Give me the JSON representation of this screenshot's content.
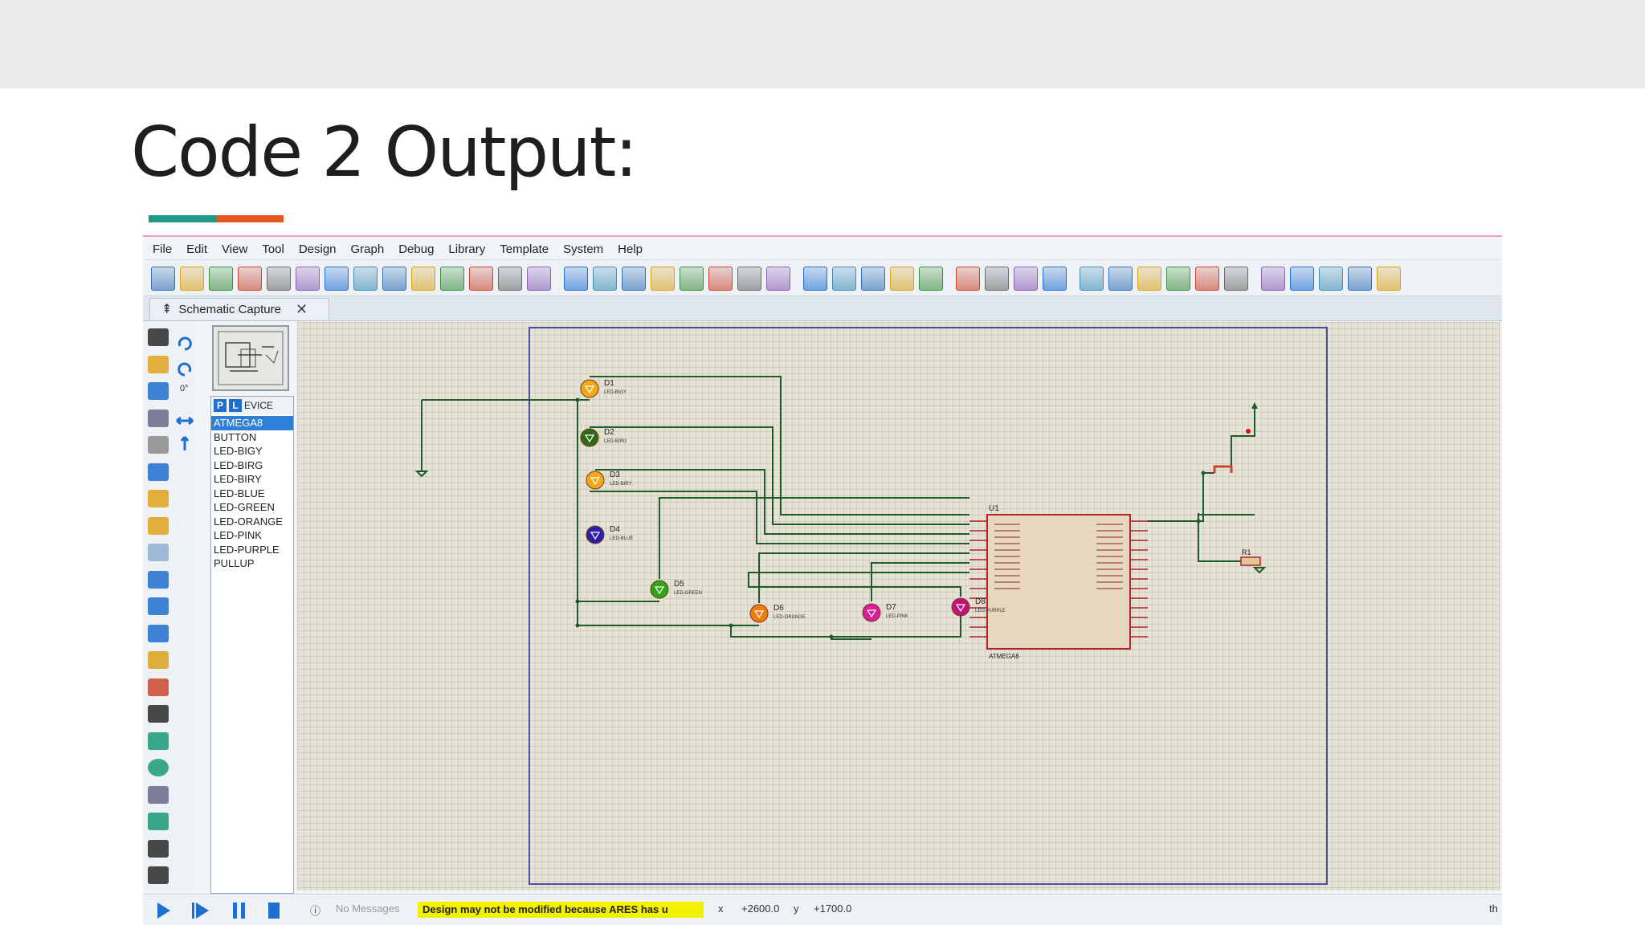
{
  "slide": {
    "title": "Code 2 Output:",
    "accent_colors": [
      "#1f9a86",
      "#e2571e"
    ]
  },
  "menu": [
    "File",
    "Edit",
    "View",
    "Tool",
    "Design",
    "Graph",
    "Debug",
    "Library",
    "Template",
    "System",
    "Help"
  ],
  "toolbar_icons": [
    "new-file-icon",
    "open-folder-icon",
    "save-icon",
    "import-icon",
    "home-icon",
    "component-icon",
    "chip-icon",
    "back-icon",
    "search-icon",
    "battery-icon",
    "bill-of-materials-icon",
    "netlist-icon",
    "document-icon",
    "help-icon",
    "refresh-icon",
    "grid-icon",
    "origin-icon",
    "pan-icon",
    "zoom-in-icon",
    "zoom-out-icon",
    "zoom-all-icon",
    "zoom-area-icon",
    "undo-icon",
    "redo-icon",
    "cut-icon",
    "copy-icon",
    "paste-icon",
    "block-copy-icon",
    "block-move-icon",
    "block-rotate-icon",
    "block-delete-icon",
    "pick-parts-icon",
    "make-device-icon",
    "package-tool-icon",
    "decompose-icon",
    "wire-autorouter-icon",
    "search-tag-icon",
    "property-assignment-icon",
    "new-sheet-icon",
    "delete-sheet-icon",
    "goto-sheet-icon",
    "edit-icon"
  ],
  "tab": {
    "label": "Schematic Capture"
  },
  "left_tools": [
    "selection-icon",
    "component-mode-icon",
    "junction-icon",
    "wire-label-icon",
    "text-script-icon",
    "buses-icon",
    "subcircuit-icon",
    "terminal-icon",
    "device-pin-icon",
    "graph-icon",
    "tape-recorder-icon",
    "generator-icon",
    "voltage-probe-icon",
    "current-probe-icon",
    "line-icon",
    "box-icon",
    "circle-icon",
    "arc-icon",
    "path-icon",
    "text-icon",
    "symbol-icon"
  ],
  "rotation": {
    "angle": "0°"
  },
  "devices": {
    "header_label": "EVICE",
    "p_label": "P",
    "l_label": "L",
    "items": [
      "ATMEGA8",
      "BUTTON",
      "LED-BIGY",
      "LED-BIRG",
      "LED-BIRY",
      "LED-BLUE",
      "LED-GREEN",
      "LED-ORANGE",
      "LED-PINK",
      "LED-PURPLE",
      "PULLUP"
    ],
    "selected_index": 0
  },
  "schematic": {
    "mcu": {
      "ref": "U1",
      "part": "ATMEGA8"
    },
    "resistor": {
      "ref": "R1"
    },
    "leds": [
      {
        "ref": "D1",
        "part": "LED-BIGY",
        "color": "#f2a81a"
      },
      {
        "ref": "D2",
        "part": "LED-BIRG",
        "color": "#2f6b17"
      },
      {
        "ref": "D3",
        "part": "LED-BIRY",
        "color": "#f2a81a"
      },
      {
        "ref": "D4",
        "part": "LED-BLUE",
        "color": "#2e1fa8"
      },
      {
        "ref": "D5",
        "part": "LED-GREEN",
        "color": "#2ea515"
      },
      {
        "ref": "D6",
        "part": "LED-ORANGE",
        "color": "#ee7a10"
      },
      {
        "ref": "D7",
        "part": "LED-PINK",
        "color": "#d81e9b"
      },
      {
        "ref": "D8",
        "part": "LED-PURPLE",
        "color": "#c0137a"
      }
    ],
    "wire_color": "#1f5a2a",
    "chip_border_color": "#b4232b",
    "chip_fill_color": "#e8d7bf",
    "sheet_border_color": "#4a4aa8"
  },
  "status": {
    "messages": "No Messages",
    "warning": "Design may not be modified because ARES has u",
    "x_label": "x",
    "x_value": "+2600.0",
    "y_label": "y",
    "y_value": "+1700.0",
    "right_text": "th"
  }
}
